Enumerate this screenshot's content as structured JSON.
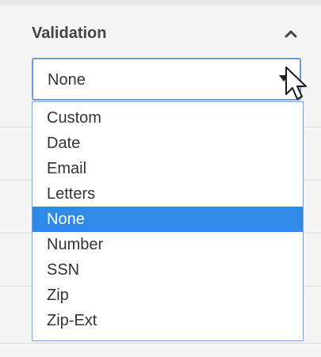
{
  "validation": {
    "title": "Validation",
    "toggle_icon": "chevron-up-icon",
    "selected_value": "None",
    "dropdown_icon": "triangle-down-icon",
    "options": [
      "Custom",
      "Date",
      "Email",
      "Letters",
      "None",
      "Number",
      "SSN",
      "Zip",
      "Zip-Ext"
    ],
    "selected_index": 4
  },
  "colors": {
    "accent": "#2e8ae6",
    "focus_border": "#6f9bd8",
    "panel_background": "#f4f4f4"
  }
}
